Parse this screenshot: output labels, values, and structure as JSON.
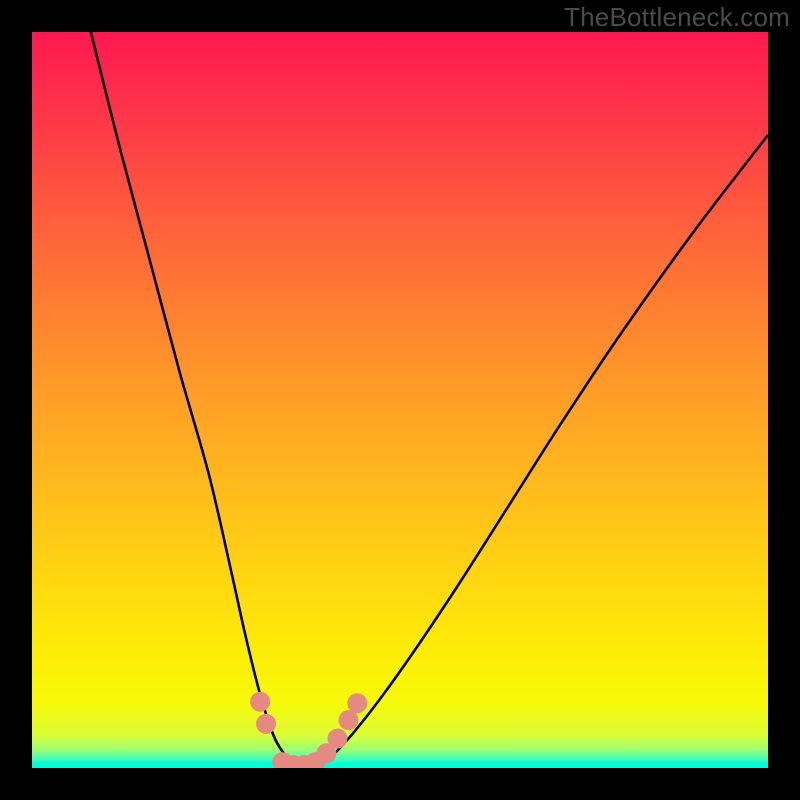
{
  "watermark": "TheBottleneck.com",
  "chart_data": {
    "type": "line",
    "title": "",
    "xlabel": "",
    "ylabel": "",
    "xlim": [
      0,
      100
    ],
    "ylim": [
      0,
      100
    ],
    "grid": false,
    "legend": false,
    "series": [
      {
        "name": "bottleneck-curve",
        "x": [
          8,
          12,
          16,
          20,
          24,
          27,
          29,
          31,
          33,
          35,
          36,
          37,
          38,
          40,
          43,
          47,
          52,
          58,
          65,
          72,
          80,
          90,
          100
        ],
        "values": [
          100,
          84,
          69,
          54,
          40,
          27,
          18,
          10,
          4,
          1,
          0,
          0,
          0,
          1,
          4,
          9,
          16,
          25,
          36,
          47,
          59,
          73,
          86
        ]
      }
    ],
    "markers": [
      {
        "x": 31.0,
        "y": 9.0
      },
      {
        "x": 31.8,
        "y": 6.0
      },
      {
        "x": 34.0,
        "y": 0.8
      },
      {
        "x": 35.5,
        "y": 0.4
      },
      {
        "x": 37.0,
        "y": 0.4
      },
      {
        "x": 38.5,
        "y": 0.8
      },
      {
        "x": 40.0,
        "y": 2.0
      },
      {
        "x": 41.5,
        "y": 4.0
      },
      {
        "x": 43.0,
        "y": 6.5
      },
      {
        "x": 44.2,
        "y": 8.8
      }
    ],
    "marker_color": "#e58a82",
    "curve_color": "#000000",
    "gradient_colors": {
      "top": "#fe1850",
      "mid": "#ffdd0e",
      "bottom": "#00ffd8"
    }
  }
}
